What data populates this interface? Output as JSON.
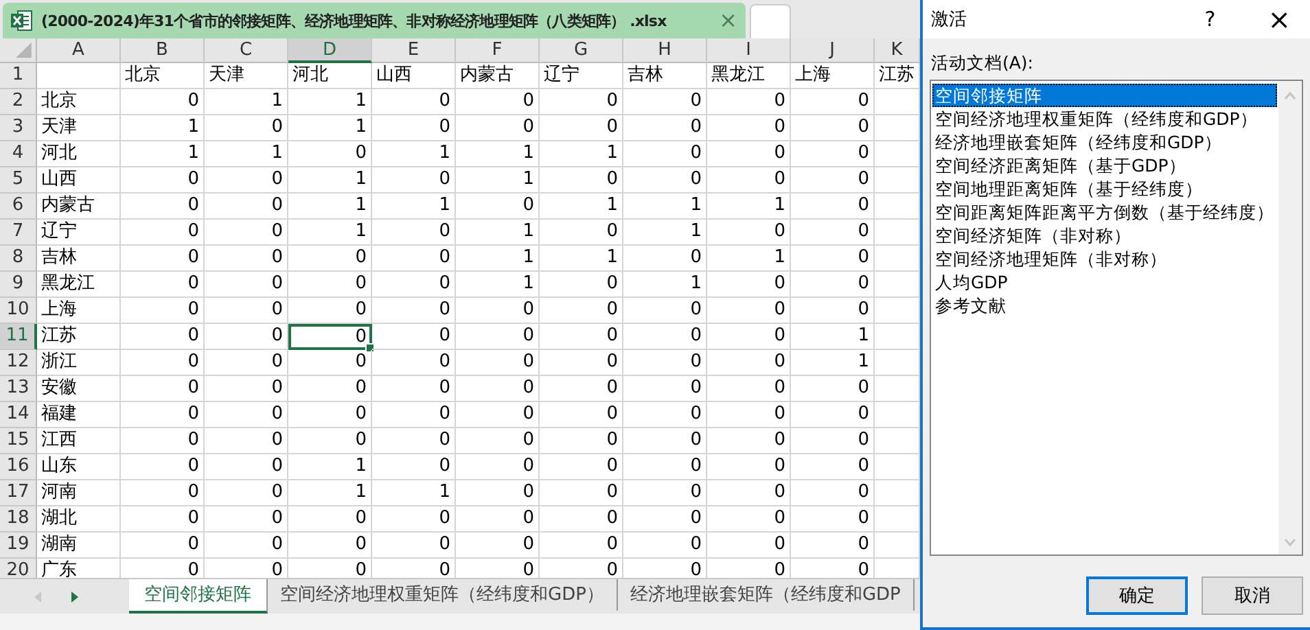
{
  "file_tab": {
    "title": "(2000-2024)年31个省市的邻接矩阵、经济地理矩阵、非对称经济地理矩阵（八类矩阵） .xlsx",
    "close": "×",
    "selected": true
  },
  "sheet": {
    "columns": [
      {
        "label": "A",
        "selected": false
      },
      {
        "label": "B",
        "selected": false
      },
      {
        "label": "C",
        "selected": false
      },
      {
        "label": "D",
        "selected": true
      },
      {
        "label": "E",
        "selected": false
      },
      {
        "label": "F",
        "selected": false
      },
      {
        "label": "G",
        "selected": false
      },
      {
        "label": "H",
        "selected": false
      },
      {
        "label": "I",
        "selected": false
      },
      {
        "label": "J",
        "selected": false
      },
      {
        "label": "K",
        "selected": false
      }
    ],
    "header_row": {
      "number": "1",
      "selected": false,
      "cells": [
        "北京",
        "天津",
        "河北",
        "山西",
        "内蒙古",
        "辽宁",
        "吉林",
        "黑龙江",
        "上海",
        "江苏"
      ]
    },
    "rows": [
      {
        "number": "2",
        "selected": false,
        "name": "北京",
        "values": [
          "0",
          "1",
          "1",
          "0",
          "0",
          "0",
          "0",
          "0",
          "0"
        ]
      },
      {
        "number": "3",
        "selected": false,
        "name": "天津",
        "values": [
          "1",
          "0",
          "1",
          "0",
          "0",
          "0",
          "0",
          "0",
          "0"
        ]
      },
      {
        "number": "4",
        "selected": false,
        "name": "河北",
        "values": [
          "1",
          "1",
          "0",
          "1",
          "1",
          "1",
          "0",
          "0",
          "0"
        ]
      },
      {
        "number": "5",
        "selected": false,
        "name": "山西",
        "values": [
          "0",
          "0",
          "1",
          "0",
          "1",
          "0",
          "0",
          "0",
          "0"
        ]
      },
      {
        "number": "6",
        "selected": false,
        "name": "内蒙古",
        "values": [
          "0",
          "0",
          "1",
          "1",
          "0",
          "1",
          "1",
          "1",
          "0"
        ]
      },
      {
        "number": "7",
        "selected": false,
        "name": "辽宁",
        "values": [
          "0",
          "0",
          "1",
          "0",
          "1",
          "0",
          "1",
          "0",
          "0"
        ]
      },
      {
        "number": "8",
        "selected": false,
        "name": "吉林",
        "values": [
          "0",
          "0",
          "0",
          "0",
          "1",
          "1",
          "0",
          "1",
          "0"
        ]
      },
      {
        "number": "9",
        "selected": false,
        "name": "黑龙江",
        "values": [
          "0",
          "0",
          "0",
          "0",
          "1",
          "0",
          "1",
          "0",
          "0"
        ]
      },
      {
        "number": "10",
        "selected": false,
        "name": "上海",
        "values": [
          "0",
          "0",
          "0",
          "0",
          "0",
          "0",
          "0",
          "0",
          "0"
        ]
      },
      {
        "number": "11",
        "selected": true,
        "name": "江苏",
        "values": [
          "0",
          "0",
          "0",
          "0",
          "0",
          "0",
          "0",
          "0",
          "1"
        ]
      },
      {
        "number": "12",
        "selected": false,
        "name": "浙江",
        "values": [
          "0",
          "0",
          "0",
          "0",
          "0",
          "0",
          "0",
          "0",
          "1"
        ]
      },
      {
        "number": "13",
        "selected": false,
        "name": "安徽",
        "values": [
          "0",
          "0",
          "0",
          "0",
          "0",
          "0",
          "0",
          "0",
          "0"
        ]
      },
      {
        "number": "14",
        "selected": false,
        "name": "福建",
        "values": [
          "0",
          "0",
          "0",
          "0",
          "0",
          "0",
          "0",
          "0",
          "0"
        ]
      },
      {
        "number": "15",
        "selected": false,
        "name": "江西",
        "values": [
          "0",
          "0",
          "0",
          "0",
          "0",
          "0",
          "0",
          "0",
          "0"
        ]
      },
      {
        "number": "16",
        "selected": false,
        "name": "山东",
        "values": [
          "0",
          "0",
          "1",
          "0",
          "0",
          "0",
          "0",
          "0",
          "0"
        ]
      },
      {
        "number": "17",
        "selected": false,
        "name": "河南",
        "values": [
          "0",
          "0",
          "1",
          "1",
          "0",
          "0",
          "0",
          "0",
          "0"
        ]
      },
      {
        "number": "18",
        "selected": false,
        "name": "湖北",
        "values": [
          "0",
          "0",
          "0",
          "0",
          "0",
          "0",
          "0",
          "0",
          "0"
        ]
      },
      {
        "number": "19",
        "selected": false,
        "name": "湖南",
        "values": [
          "0",
          "0",
          "0",
          "0",
          "0",
          "0",
          "0",
          "0",
          "0"
        ]
      },
      {
        "number": "20",
        "selected": false,
        "name": "广东",
        "values": [
          "0",
          "0",
          "0",
          "0",
          "0",
          "0",
          "0",
          "0",
          "0"
        ]
      }
    ]
  },
  "sheet_tabs": [
    {
      "label": "空间邻接矩阵",
      "selected": true
    },
    {
      "label": "空间经济地理权重矩阵（经纬度和GDP）",
      "selected": false
    },
    {
      "label": "经济地理嵌套矩阵（经纬度和GDP",
      "selected": false
    }
  ],
  "dialog": {
    "title": "激活",
    "help": "?",
    "close": "×",
    "label": "活动文档(A):",
    "items": [
      {
        "label": "空间邻接矩阵",
        "selected": true
      },
      {
        "label": "空间经济地理权重矩阵（经纬度和GDP）",
        "selected": false
      },
      {
        "label": "经济地理嵌套矩阵（经纬度和GDP）",
        "selected": false
      },
      {
        "label": "空间经济距离矩阵（基于GDP）",
        "selected": false
      },
      {
        "label": "空间地理距离矩阵（基于经纬度）",
        "selected": false
      },
      {
        "label": "空间距离矩阵距离平方倒数（基于经纬度）",
        "selected": false
      },
      {
        "label": "空间经济矩阵（非对称）",
        "selected": false
      },
      {
        "label": "空间经济地理矩阵（非对称）",
        "selected": false
      },
      {
        "label": "人均GDP",
        "selected": false
      },
      {
        "label": "参考文献",
        "selected": false
      }
    ],
    "buttons": [
      {
        "label": "确定",
        "default": true
      },
      {
        "label": "取消",
        "default": false
      }
    ]
  }
}
